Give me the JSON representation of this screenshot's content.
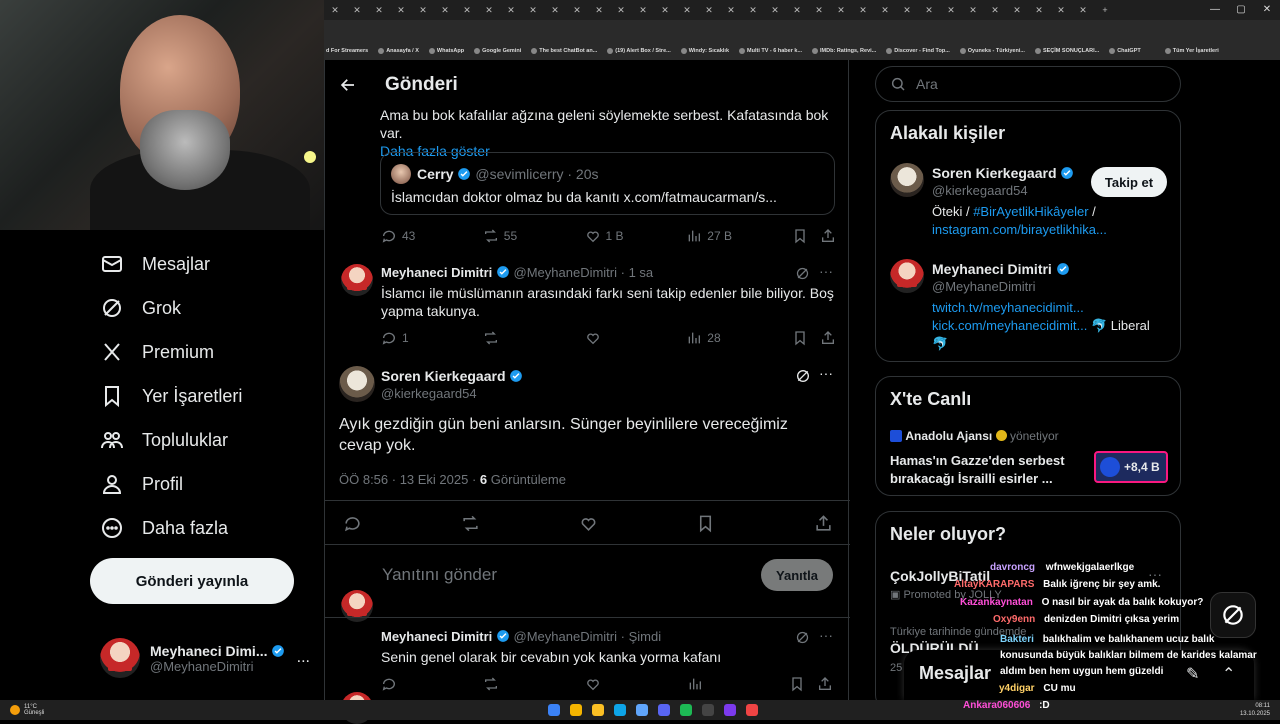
{
  "browser": {
    "bookmarks": [
      "d For Streamers",
      "Anasayfa / X",
      "WhatsApp",
      "Google Gemini",
      "The best ChatBot an...",
      "(19) Alert Box / Stre...",
      "Windy: Sıcaklık",
      "Multi TV - 6 haber k...",
      "IMDb: Ratings, Revi...",
      "Discover - Find Top...",
      "Oyuneks - Türkiyeni...",
      "SEÇİM SONUÇLARI...",
      "ChatGPT",
      "Tüm Yer İşaretleri"
    ]
  },
  "nav": {
    "items": [
      {
        "label": "Mesajlar",
        "icon": "mail-icon"
      },
      {
        "label": "Grok",
        "icon": "grok-icon"
      },
      {
        "label": "Premium",
        "icon": "x-logo-icon"
      },
      {
        "label": "Yer İşaretleri",
        "icon": "bookmark-icon"
      },
      {
        "label": "Topluluklar",
        "icon": "communities-icon"
      },
      {
        "label": "Profil",
        "icon": "profile-icon"
      },
      {
        "label": "Daha fazla",
        "icon": "more-circle-icon"
      }
    ],
    "post_button": "Gönderi yayınla",
    "account": {
      "name": "Meyhaneci Dimi...",
      "handle": "@MeyhaneDimitri",
      "more": "..."
    }
  },
  "header": {
    "title": "Gönderi"
  },
  "thread": {
    "top_text": "Ama bu bok kafalılar ağzına geleni söylemekte serbest. Kafatasında bok var.",
    "show_more": "Daha fazla göster",
    "quote": {
      "name": "Cerry",
      "handle": "@sevimlicerry",
      "time": "· 20s",
      "text": "İslamcıdan doktor olmaz bu da kanıtı x.com/fatmaucarman/s..."
    },
    "top_actions": {
      "replies": "43",
      "reposts": "55",
      "likes": "1 B",
      "views": "27 B"
    },
    "reply1": {
      "name": "Meyhaneci Dimitri",
      "handle": "@MeyhaneDimitri",
      "time": "· 1 sa",
      "text": "İslamcı ile müslümanın arasındaki farkı seni takip edenler bile biliyor. Boş yapma takunya.",
      "replies": "1",
      "views": "28"
    },
    "main": {
      "name": "Soren Kierkegaard",
      "handle": "@kierkegaard54",
      "text": "Ayık gezdiğin gün beni anlarsın. Sünger beyinlilere vereceğimiz cevap yok.",
      "timestamp": "ÖÖ 8:56 · 13 Eki 2025 ·",
      "views_count": "6",
      "views_label": "Görüntüleme"
    },
    "compose": {
      "placeholder": "Yanıtını gönder",
      "button": "Yanıtla"
    },
    "reply2": {
      "name": "Meyhaneci Dimitri",
      "handle": "@MeyhaneDimitri",
      "time": "· Şimdi",
      "text": "Senin genel olarak bir cevabın yok kanka yorma kafanı"
    }
  },
  "sidebar": {
    "search_placeholder": "Ara",
    "related": {
      "title": "Alakalı kişiler",
      "p1": {
        "name": "Soren Kierkegaard",
        "handle": "@kierkegaard54",
        "follow": "Takip et",
        "bio_pre": "Öteki / ",
        "bio_tag": "#BirAyetlikHikâyeler",
        "bio_post": " /",
        "bio_link": "instagram.com/birayetlikhika..."
      },
      "p2": {
        "name": "Meyhaneci Dimitri",
        "handle": "@MeyhaneDimitri",
        "link1": "twitch.tv/meyhanecidimit...",
        "link2": "kick.com/meyhanecidimit...",
        "tail": "🐬 Liberal",
        "tail2": "🐬"
      }
    },
    "live": {
      "title": "X'te Canlı",
      "host": "Anadolu Ajansı",
      "host_role": "yönetiyor",
      "headline": "Hamas'ın Gazze'den serbest bırakacağı İsrailli esirler ...",
      "count": "+8,4 B"
    },
    "trends": {
      "title": "Neler oluyor?",
      "t1": "ÇokJollyBiTatil",
      "t1_sub": "Promoted by JOLLY",
      "t2_cat": "Türkiye tarihinde gündemde",
      "t2": "ÖLDÜRÜLDÜ",
      "t2_count": "25"
    },
    "messages_dock": "Mesajlar"
  },
  "chat": [
    {
      "user": "davroncg",
      "color": "#c8a2ff",
      "msg": "wfnwekjgalaerlkge"
    },
    {
      "user": "AltayKARAPARS",
      "color": "#ff6b6b",
      "msg": "Balık iğrenç bir şey amk."
    },
    {
      "user": "Kazankaynatan",
      "color": "#ff4fd8",
      "msg": "O nasıl bir ayak da balık kokuyor?"
    },
    {
      "user": "Oxy9enn",
      "color": "#ff6b6b",
      "msg": "denizden Dimitri çıksa yerim"
    },
    {
      "user": "Bakteri",
      "color": "#7dd3fc",
      "msg": "balıkhalim ve balıkhanem ucuz balık konusunda büyük balıkları bilmem de karides kalamar aldım ben hem uygun hem güzeldi"
    },
    {
      "user": "y4digar",
      "color": "#ffd166",
      "msg": "CU mu"
    },
    {
      "user": "Ankara060606",
      "color": "#ff4fd8",
      "msg": ":D"
    }
  ],
  "taskbar": {
    "weather_temp": "11°C",
    "weather_desc": "Güneşli",
    "time": "08:11",
    "date": "13.10.2025"
  }
}
